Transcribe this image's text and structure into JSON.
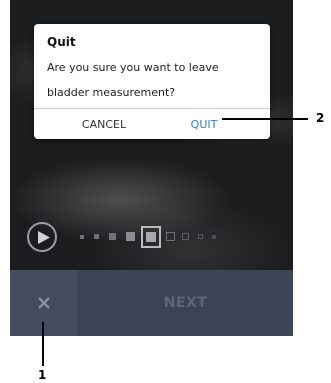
{
  "dialog": {
    "title": "Quit",
    "message": "Are you sure you want to leave bladder measurement?",
    "cancel_label": "CANCEL",
    "quit_label": "QUIT"
  },
  "toolbar": {
    "close_icon": "close-icon",
    "next_label": "NEXT"
  },
  "player": {
    "play_icon": "play-icon",
    "frames_total": 10,
    "current_frame": 5
  },
  "callouts": [
    {
      "label": "1"
    },
    {
      "label": "2"
    }
  ],
  "colors": {
    "accent": "#2d7fd0",
    "bottom_bar": "#3b4457",
    "close_bg": "#444d60"
  }
}
